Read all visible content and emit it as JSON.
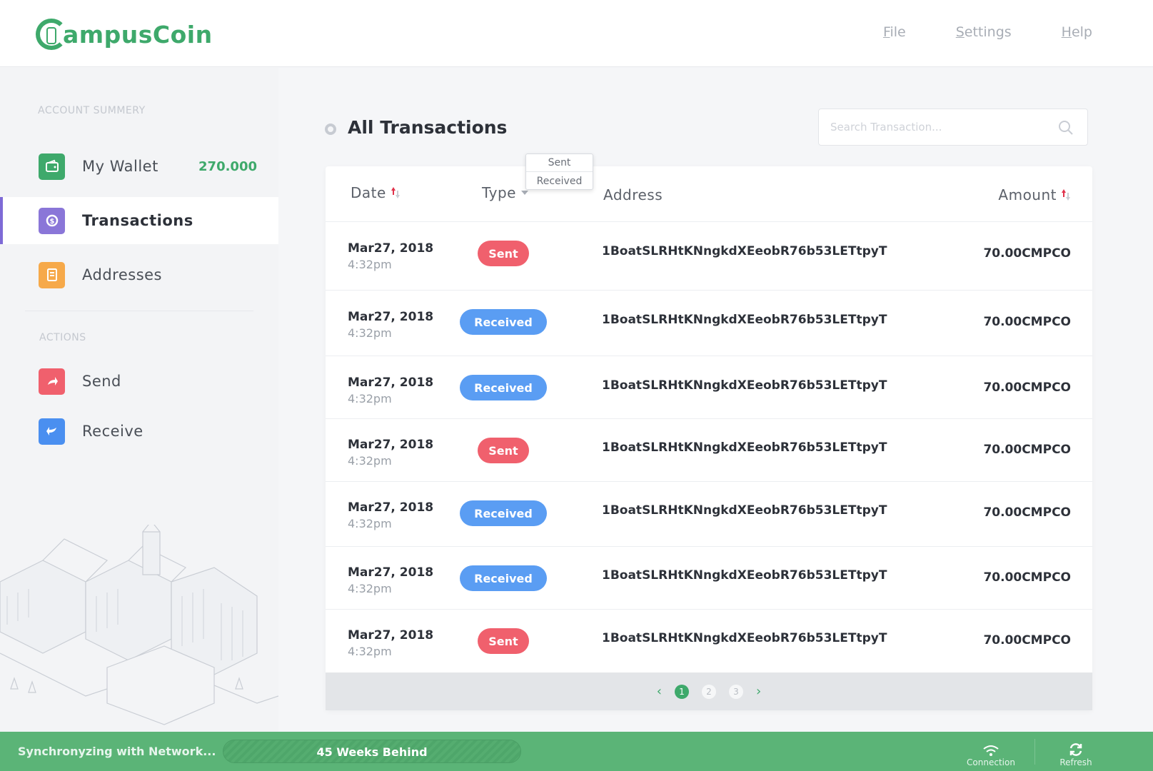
{
  "app": {
    "name": "CampusCoin",
    "name_rest": "ampusCoin",
    "brand_color": "#3ea96b"
  },
  "top_menu": [
    "File",
    "Settings",
    "Help"
  ],
  "sidebar": {
    "account_label": "ACCOUNT SUMMERY",
    "wallet_label": "My Wallet",
    "wallet_balance": "270.000",
    "transactions_label": "Transactions",
    "addresses_label": "Addresses",
    "actions_label": "ACTIONS",
    "send_label": "Send",
    "receive_label": "Receive"
  },
  "main": {
    "title": "All Transactions",
    "search_placeholder": "Search Transaction...",
    "columns": {
      "date": "Date",
      "type": "Type",
      "address": "Address",
      "amount": "Amount"
    },
    "type_filter_options": [
      "Sent",
      "Received"
    ],
    "transactions": [
      {
        "date": "Mar27, 2018",
        "time": "4:32pm",
        "type": "Sent",
        "address": "1BoatSLRHtKNngkdXEeobR76b53LETtpyT",
        "amount": "70.00CMPCO"
      },
      {
        "date": "Mar27, 2018",
        "time": "4:32pm",
        "type": "Received",
        "address": "1BoatSLRHtKNngkdXEeobR76b53LETtpyT",
        "amount": "70.00CMPCO"
      },
      {
        "date": "Mar27, 2018",
        "time": "4:32pm",
        "type": "Received",
        "address": "1BoatSLRHtKNngkdXEeobR76b53LETtpyT",
        "amount": "70.00CMPCO"
      },
      {
        "date": "Mar27, 2018",
        "time": "4:32pm",
        "type": "Sent",
        "address": "1BoatSLRHtKNngkdXEeobR76b53LETtpyT",
        "amount": "70.00CMPCO"
      },
      {
        "date": "Mar27, 2018",
        "time": "4:32pm",
        "type": "Received",
        "address": "1BoatSLRHtKNngkdXEeobR76b53LETtpyT",
        "amount": "70.00CMPCO"
      },
      {
        "date": "Mar27, 2018",
        "time": "4:32pm",
        "type": "Received",
        "address": "1BoatSLRHtKNngkdXEeobR76b53LETtpyT",
        "amount": "70.00CMPCO"
      },
      {
        "date": "Mar27, 2018",
        "time": "4:32pm",
        "type": "Sent",
        "address": "1BoatSLRHtKNngkdXEeobR76b53LETtpyT",
        "amount": "70.00CMPCO"
      }
    ],
    "pagination": {
      "pages": [
        "1",
        "2",
        "3"
      ],
      "current": "1"
    }
  },
  "footer": {
    "sync_text": "Synchronyzing with Network...",
    "sync_status": "45 Weeks Behind",
    "connection_label": "Connection",
    "refresh_label": "Refresh"
  },
  "colors": {
    "sent": "#f0606d",
    "received": "#5a9df3",
    "footer": "#5bb477",
    "active_nav": "#7e6ad6"
  }
}
